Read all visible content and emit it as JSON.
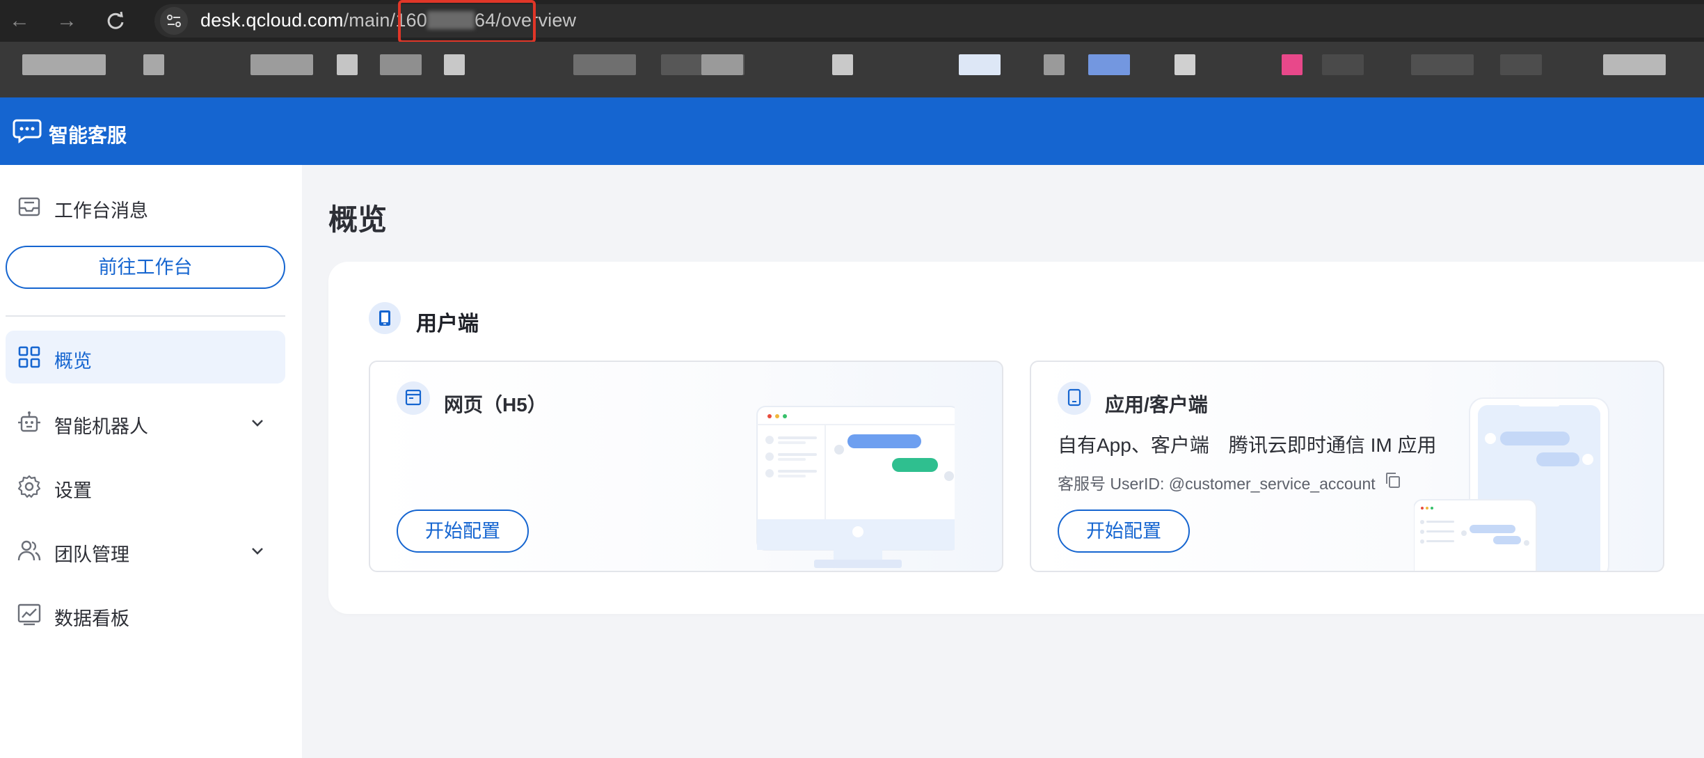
{
  "browser": {
    "url_host": "desk.qcloud.com",
    "url_path_start": "/main/160",
    "url_path_end": "64/overview"
  },
  "app": {
    "brand_name": "智能客服",
    "brand_icon": "chat-bubble-icon"
  },
  "sidebar": {
    "workbench_messages": "工作台消息",
    "goto_workbench": "前往工作台",
    "items": [
      {
        "label": "概览",
        "icon": "grid-icon",
        "active": true
      },
      {
        "label": "智能机器人",
        "icon": "robot-icon",
        "expandable": true
      },
      {
        "label": "设置",
        "icon": "gear-icon"
      },
      {
        "label": "团队管理",
        "icon": "team-icon",
        "expandable": true
      },
      {
        "label": "数据看板",
        "icon": "chart-icon"
      }
    ]
  },
  "main": {
    "page_title": "概览",
    "section_title": "用户端",
    "cards": [
      {
        "title": "网页（H5）",
        "button": "开始配置"
      },
      {
        "title": "应用/客户端",
        "description": "自有App、客户端　腾讯云即时通信 IM 应用",
        "meta": "客服号 UserID: @customer_service_account",
        "button": "开始配置"
      }
    ]
  },
  "colors": {
    "brand": "#1565d0",
    "highlight_border": "#e03628"
  }
}
